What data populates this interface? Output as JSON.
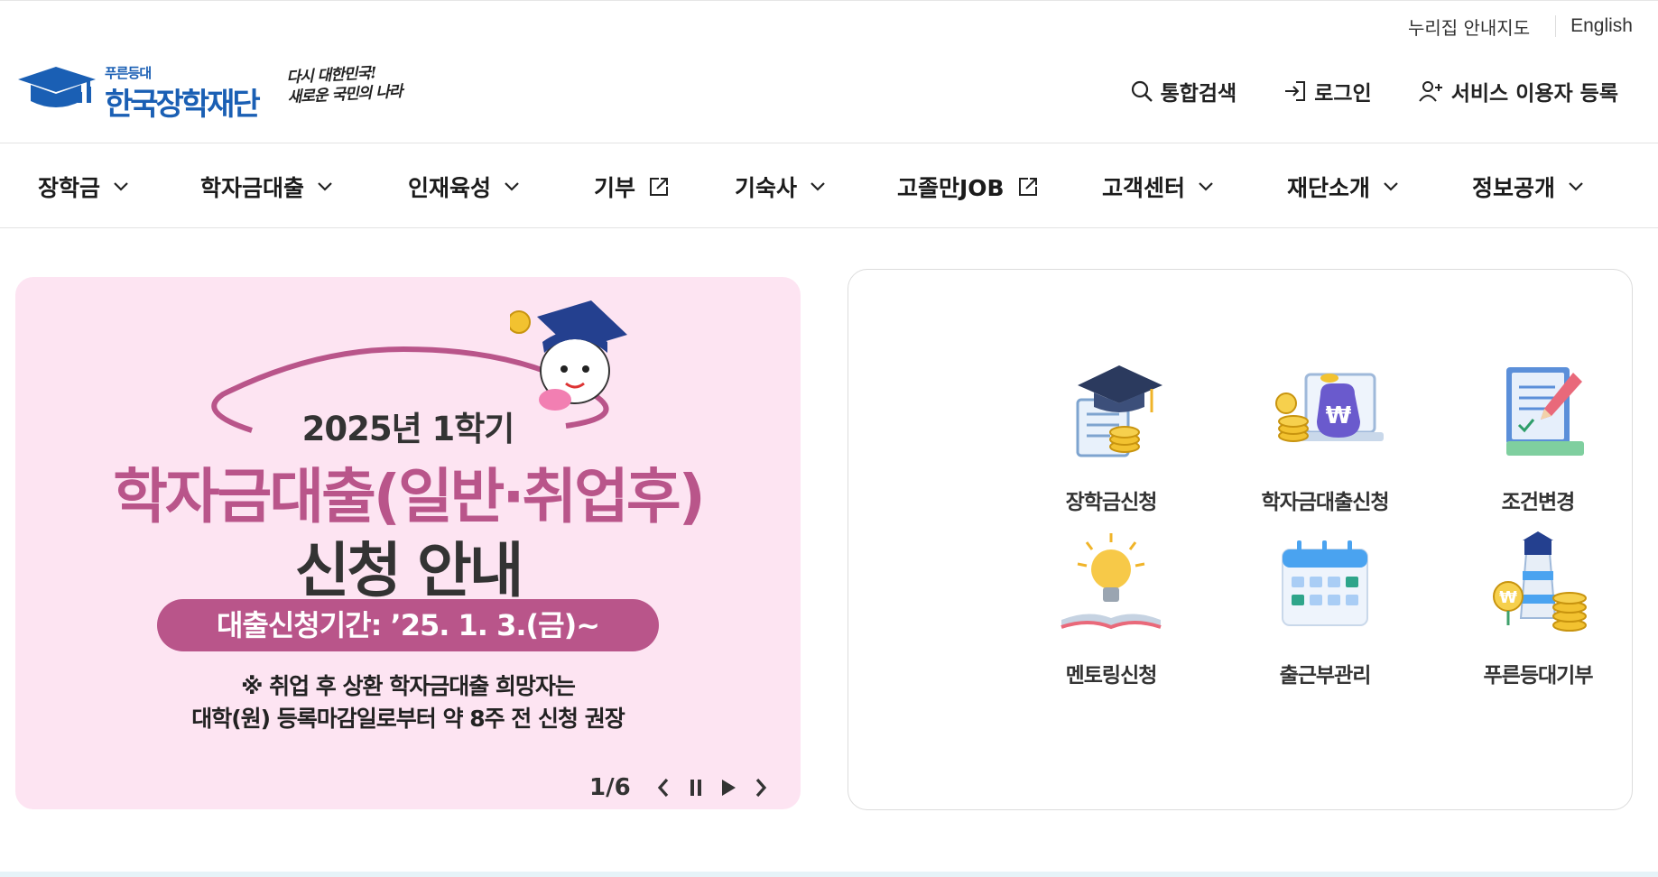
{
  "util": {
    "sitemap": "누리집 안내지도",
    "lang": "English"
  },
  "logo": {
    "small": "푸른등대",
    "name": "한국장학재단",
    "slogan_line1": "다시 대한민국!",
    "slogan_line2": "새로운 국민의 나라"
  },
  "header_actions": {
    "search": "통합검색",
    "login": "로그인",
    "register": "서비스 이용자 등록"
  },
  "gnb": [
    {
      "label": "장학금",
      "type": "dropdown"
    },
    {
      "label": "학자금대출",
      "type": "dropdown"
    },
    {
      "label": "인재육성",
      "type": "dropdown"
    },
    {
      "label": "기부",
      "type": "external"
    },
    {
      "label": "기숙사",
      "type": "dropdown"
    },
    {
      "label": "고졸만JOB",
      "type": "external"
    },
    {
      "label": "고객센터",
      "type": "dropdown"
    },
    {
      "label": "재단소개",
      "type": "dropdown"
    },
    {
      "label": "정보공개",
      "type": "dropdown"
    }
  ],
  "banner": {
    "year": "2025년 1학기",
    "title1": "학자금대출(일반·취업후)",
    "title2": "신청 안내",
    "period": "대출신청기간: ’25. 1. 3.(금)~",
    "note1": "※  취업 후 상환 학자금대출 희망자는",
    "note2": "대학(원) 등록마감일로부터 약 8주 전 신청 권장",
    "pager": "1/6",
    "colors": {
      "bg": "#fde4f2",
      "accent": "#b9558a"
    }
  },
  "quick_menu": [
    {
      "label": "장학금신청",
      "icon": "graduation-cap-icon"
    },
    {
      "label": "학자금대출신청",
      "icon": "money-bag-icon"
    },
    {
      "label": "조건변경",
      "icon": "document-pencil-icon"
    },
    {
      "label": "멘토링신청",
      "icon": "lightbulb-book-icon"
    },
    {
      "label": "출근부관리",
      "icon": "calendar-icon"
    },
    {
      "label": "푸른등대기부",
      "icon": "lighthouse-coins-icon"
    }
  ]
}
